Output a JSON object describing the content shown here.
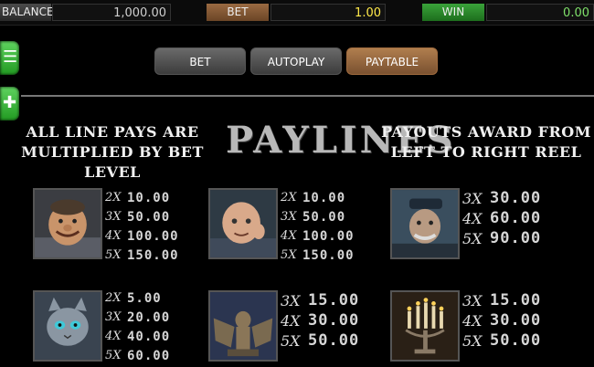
{
  "topbar": {
    "balance_label": "BALANCE",
    "balance_value": "1,000.00",
    "bet_label": "BET",
    "bet_value": "1.00",
    "win_label": "WIN",
    "win_value": "0.00"
  },
  "side": {
    "menu_icon": "hamburger-menu-icon",
    "add_icon": "plus-icon"
  },
  "tabs": [
    {
      "label": "BET"
    },
    {
      "label": "AUTOPLAY"
    },
    {
      "label": "PAYTABLE",
      "active": true
    }
  ],
  "paytable": {
    "left_caption_l1": "ALL LINE PAYS ARE",
    "left_caption_l2": "MULTIPLIED BY BET LEVEL",
    "title": "PAYLINES",
    "right_caption_l1": "PAYOUTS AWARD FROM",
    "right_caption_l2": "LEFT TO RIGHT REEL",
    "symbols": [
      {
        "name": "smiling-man-symbol",
        "pays": [
          {
            "mult": "2X",
            "amount": "10.00"
          },
          {
            "mult": "3X",
            "amount": "50.00"
          },
          {
            "mult": "4X",
            "amount": "100.00"
          },
          {
            "mult": "5X",
            "amount": "150.00"
          }
        ]
      },
      {
        "name": "old-man-symbol",
        "pays": [
          {
            "mult": "2X",
            "amount": "10.00"
          },
          {
            "mult": "3X",
            "amount": "50.00"
          },
          {
            "mult": "4X",
            "amount": "100.00"
          },
          {
            "mult": "5X",
            "amount": "150.00"
          }
        ]
      },
      {
        "name": "captain-symbol",
        "pays": [
          {
            "mult": "3X",
            "amount": "30.00"
          },
          {
            "mult": "4X",
            "amount": "60.00"
          },
          {
            "mult": "5X",
            "amount": "90.00"
          }
        ]
      },
      {
        "name": "cat-symbol",
        "pays": [
          {
            "mult": "2X",
            "amount": "5.00"
          },
          {
            "mult": "3X",
            "amount": "20.00"
          },
          {
            "mult": "4X",
            "amount": "40.00"
          },
          {
            "mult": "5X",
            "amount": "60.00"
          }
        ]
      },
      {
        "name": "gargoyle-symbol",
        "pays": [
          {
            "mult": "3X",
            "amount": "15.00"
          },
          {
            "mult": "4X",
            "amount": "30.00"
          },
          {
            "mult": "5X",
            "amount": "50.00"
          }
        ]
      },
      {
        "name": "candelabra-symbol",
        "pays": [
          {
            "mult": "3X",
            "amount": "15.00"
          },
          {
            "mult": "4X",
            "amount": "30.00"
          },
          {
            "mult": "5X",
            "amount": "50.00"
          }
        ]
      }
    ]
  },
  "colors": {
    "bet_accent": "#8a5a32",
    "win_accent": "#2f9a2f",
    "bet_value": "#ffe94a",
    "win_value": "#7fe06a"
  }
}
